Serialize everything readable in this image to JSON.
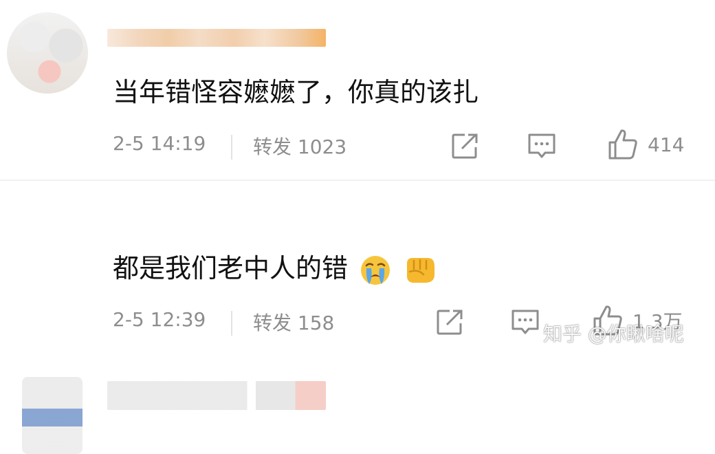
{
  "comments": [
    {
      "text": "当年错怪容嬷嬷了，你真的该扎",
      "time": "2-5 14:19",
      "repost_label": "转发 1023",
      "like_count": "414",
      "emojis": []
    },
    {
      "text": "都是我们老中人的错",
      "time": "2-5 12:39",
      "repost_label": "转发 158",
      "like_count": "1.3万",
      "emojis": [
        "crying-face",
        "oncoming-fist"
      ]
    }
  ],
  "watermark": "知乎 @你瞅啥呢",
  "colors": {
    "text": "#111111",
    "meta": "#8d8d8d",
    "divider": "#f1f1f1",
    "emoji_yellow": "#f7c53c",
    "tears": "#5aa7e8"
  }
}
